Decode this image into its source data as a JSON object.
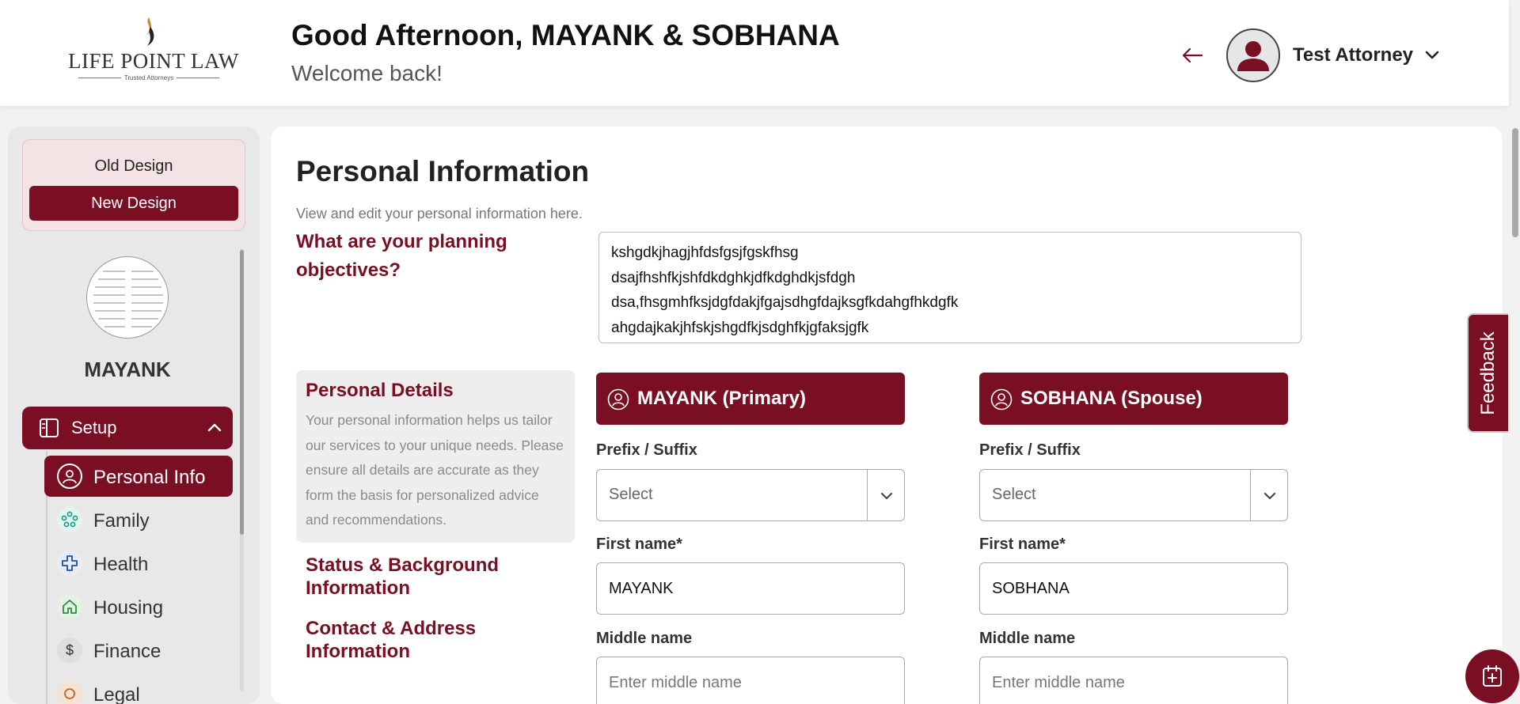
{
  "header": {
    "logo_name": "LIFE POINT LAW",
    "logo_tagline": "Trusted Attorneys",
    "greeting": "Good Afternoon, MAYANK & SOBHANA",
    "welcome": "Welcome back!",
    "user_name": "Test Attorney"
  },
  "sidebar": {
    "old_design_label": "Old Design",
    "new_design_label": "New Design",
    "profile_name": "MAYANK",
    "setup_label": "Setup",
    "items": [
      {
        "label": "Personal Info",
        "icon": "user-icon",
        "active": true
      },
      {
        "label": "Family",
        "icon": "family-icon",
        "active": false
      },
      {
        "label": "Health",
        "icon": "medical-cross-icon",
        "active": false
      },
      {
        "label": "Housing",
        "icon": "house-icon",
        "active": false
      },
      {
        "label": "Finance",
        "icon": "dollar-icon",
        "active": false
      },
      {
        "label": "Legal",
        "icon": "legal-icon",
        "active": false
      }
    ]
  },
  "main": {
    "title": "Personal Information",
    "subtitle": "View and edit your personal information here.",
    "objectives_label": "What are your planning objectives?",
    "objectives_text": "kshgdkjhagjhfdsfgsjfgskfhsg\ndsajfhshfkjshfdkdghkjdfkdghdkjsfdgh\ndsa,fhsgmhfksjdgfdakjfgajsdhgfdajksgfkdahgfhkdgfk\nahgdajkakjhfskjshgdfkjsdghfkjgfaksjgfk",
    "details_title": "Personal Details",
    "details_text": "Your personal information helps us tailor our services to your unique needs. Please ensure all details are accurate as they form the basis for personalized advice and recommendations.",
    "status_link": "Status & Background Information",
    "contact_link": "Contact & Address Information",
    "primary": {
      "header": "MAYANK (Primary)",
      "prefix_label": "Prefix / Suffix",
      "prefix_value": "Select",
      "first_name_label": "First name*",
      "first_name_value": "MAYANK",
      "middle_name_label": "Middle name",
      "middle_name_placeholder": "Enter middle name"
    },
    "spouse": {
      "header": "SOBHANA (Spouse)",
      "prefix_label": "Prefix / Suffix",
      "prefix_value": "Select",
      "first_name_label": "First name*",
      "first_name_value": "SOBHANA",
      "middle_name_label": "Middle name",
      "middle_name_placeholder": "Enter middle name"
    }
  },
  "feedback_label": "Feedback",
  "colors": {
    "accent": "#7a0f24",
    "background": "#f2f2f2"
  }
}
